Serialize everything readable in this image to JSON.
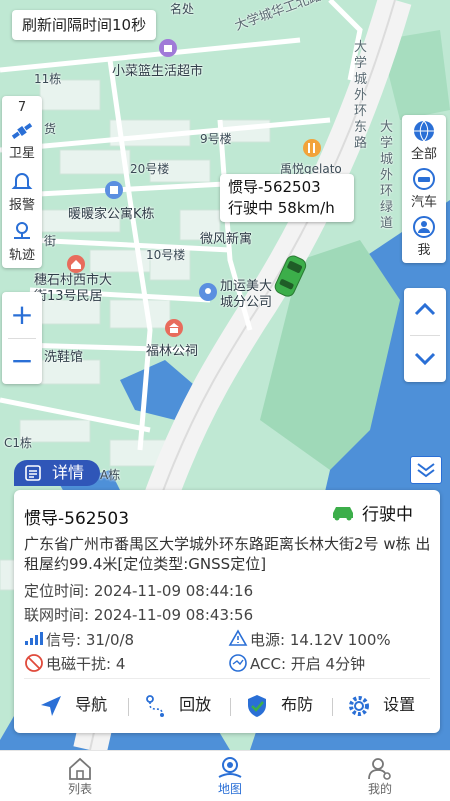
{
  "refresh_text": "刷新间隔时间10秒",
  "left_panel": {
    "count": "7",
    "satellite_label": "卫星",
    "alarm_label": "报警",
    "track_label": "轨迹"
  },
  "zoom": {
    "plus": "+",
    "minus": "−"
  },
  "right_panel": {
    "all_label": "全部",
    "car_label": "汽车",
    "me_label": "我"
  },
  "map_labels": {
    "xiaocai": "小菜篮生活超市",
    "road_top": "大学城华工北路",
    "road_right1": "大学城外环东路",
    "road_right2": "大学城外环绿道",
    "nuanuan": "暖暖家公寓K栋",
    "weifeng": "微风新寓",
    "huiyue": "禹悦gelato",
    "suishi": "穗石村西市大\n街13号民居",
    "jiayun": "加运美大\n城分公司",
    "fulin": "福林公祠",
    "xixie": "洗鞋馆",
    "b9": "9号楼",
    "b20": "20号楼",
    "b10": "10号楼",
    "b11": "11栋",
    "c1": "C1栋",
    "a": "A栋",
    "huo": "货",
    "jie": "街",
    "top_frag": "名处"
  },
  "callout": {
    "vehicle": "惯导-562503",
    "status_speed": "行驶中 58km/h"
  },
  "detail_label": "详情",
  "card": {
    "vehicle": "惯导-562503",
    "status": "行驶中",
    "address": "广东省广州市番禺区大学城外环东路距离长林大街2号 w栋 出租屋约99.4米[定位类型:GNSS定位]",
    "locate_time": "定位时间: 2024-11-09 08:44:16",
    "net_time": "联网时间: 2024-11-09 08:43:56",
    "signal": "信号: 31/0/8",
    "power": "电源: 14.12V 100%",
    "emi": "电磁干扰: 4",
    "acc": "ACC: 开启 4分钟"
  },
  "actions": {
    "navigate": "导航",
    "playback": "回放",
    "arm": "布防",
    "settings": "设置"
  },
  "tabs": {
    "list": "列表",
    "map": "地图",
    "mine": "我的"
  },
  "colors": {
    "accent": "#2a6fd6",
    "status_green": "#3cae4a",
    "map_bg": "#bfe8d3",
    "water": "#4e90d8"
  }
}
